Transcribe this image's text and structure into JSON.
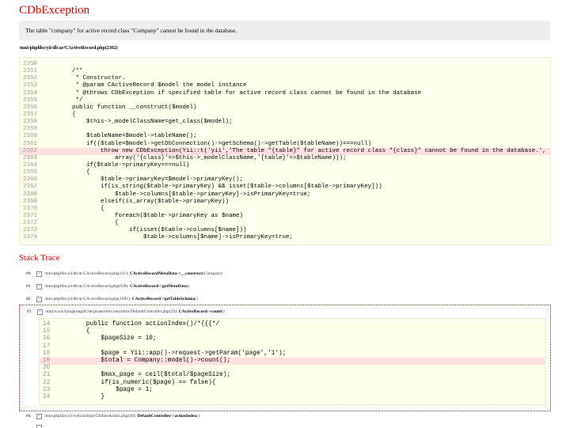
{
  "error": {
    "title": "CDbException",
    "message": "The table \"company\" for active record class \"Company\" cannot be found in the database."
  },
  "source": {
    "file": "/mnt/phplibs/yii/db/ar/CActiveRecord.php(2362)",
    "error_line": "2362",
    "lines": [
      {
        "num": "2350",
        "code": ""
      },
      {
        "num": "2351",
        "code": "    /**"
      },
      {
        "num": "2352",
        "code": "     * Constructor."
      },
      {
        "num": "2353",
        "code": "     * @param CActiveRecord $model the model instance"
      },
      {
        "num": "2354",
        "code": "     * @throws CDbException if specified table for active record class cannot be found in the database"
      },
      {
        "num": "2355",
        "code": "     */"
      },
      {
        "num": "2356",
        "code": "    public function __construct($model)"
      },
      {
        "num": "2357",
        "code": "    {"
      },
      {
        "num": "2358",
        "code": "        $this->_modelClassName=get_class($model);"
      },
      {
        "num": "2359",
        "code": ""
      },
      {
        "num": "2360",
        "code": "        $tableName=$model->tableName();"
      },
      {
        "num": "2361",
        "code": "        if(($table=$model->getDbConnection()->getSchema()->getTable($tableName))===null)"
      },
      {
        "num": "2362",
        "code": "            throw new CDbException(Yii::t('yii','The table \"{table}\" for active record class \"{class}\" cannot be found in the database.',"
      },
      {
        "num": "2363",
        "code": "                array('{class}'=>$this->_modelClassName,'{table}'=>$tableName)));"
      },
      {
        "num": "2364",
        "code": "        if($table->primaryKey===null)"
      },
      {
        "num": "2365",
        "code": "        {"
      },
      {
        "num": "2366",
        "code": "            $table->primaryKey=$model->primaryKey();"
      },
      {
        "num": "2367",
        "code": "            if(is_string($table->primaryKey) && isset($table->columns[$table->primaryKey]))"
      },
      {
        "num": "2368",
        "code": "                $table->columns[$table->primaryKey]->isPrimaryKey=true;"
      },
      {
        "num": "2369",
        "code": "            elseif(is_array($table->primaryKey))"
      },
      {
        "num": "2370",
        "code": "            {"
      },
      {
        "num": "2371",
        "code": "                foreach($table->primaryKey as $name)"
      },
      {
        "num": "2372",
        "code": "                {"
      },
      {
        "num": "2373",
        "code": "                    if(isset($table->columns[$name]))"
      },
      {
        "num": "2374",
        "code": "                        $table->columns[$name]->isPrimaryKey=true;"
      }
    ]
  },
  "stack_trace": {
    "heading": "Stack Trace",
    "items": [
      {
        "num": "#0",
        "toggle": "-",
        "location": "/mnt/phplibs/yii/db/ar/CActiveRecord.php(411): ",
        "call": "CActiveRecordMetaData->__construct",
        "args": "(Company)"
      },
      {
        "num": "#1",
        "toggle": "-",
        "location": "/mnt/phplibs/yii/db/ar/CActiveRecord.php(658): ",
        "call": "CActiveRecord->getMetaData",
        "args": "()"
      },
      {
        "num": "#2",
        "toggle": "-",
        "location": "/mnt/phplibs/yii/db/ar/CActiveRecord.php(1601): ",
        "call": "CActiveRecord->getTableSchema",
        "args": "()"
      },
      {
        "num": "#3",
        "toggle": "-",
        "location": "/mnt/www/hongkongdir.hk/protected/controllers/DefaultController.php(19): ",
        "call": "CActiveRecord->count",
        "args": "()"
      },
      {
        "num": "#4",
        "toggle": "-",
        "location": "/mnt/phplibs/yii/web/actions/CInlineAction.php(49): ",
        "call": "DefaultController->actionIndex",
        "args": "()"
      }
    ],
    "expanded_code": {
      "error_line": "19",
      "lines": [
        {
          "num": "14",
          "code": "    public function actionIndex()/*{{{*/"
        },
        {
          "num": "15",
          "code": "    {"
        },
        {
          "num": "16",
          "code": "        $pageSize = 10;"
        },
        {
          "num": "17",
          "code": ""
        },
        {
          "num": "18",
          "code": "        $page = Yii::app()->request->getParam('page','1');"
        },
        {
          "num": "19",
          "code": "        $total = Company::model()->count();"
        },
        {
          "num": "20",
          "code": ""
        },
        {
          "num": "21",
          "code": "        $max_page = ceil($total/$pageSize);"
        },
        {
          "num": "22",
          "code": "        if(is_numeric($page) == false){"
        },
        {
          "num": "23",
          "code": "            $page = 1;"
        },
        {
          "num": "24",
          "code": "        }"
        }
      ]
    }
  }
}
